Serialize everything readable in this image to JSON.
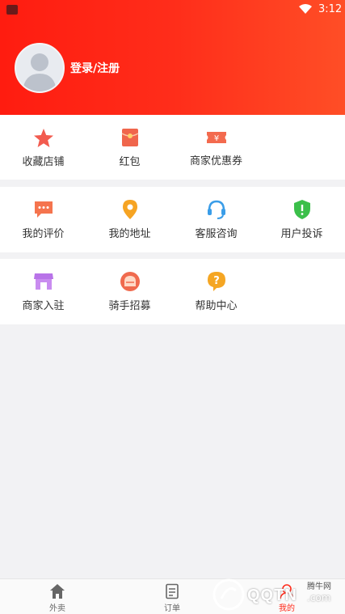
{
  "status_bar": {
    "time": "3:12",
    "wifi_icon": "wifi-icon",
    "app_icon": "notification-app-icon"
  },
  "header": {
    "login_label": "登录/注册",
    "avatar_icon": "default-avatar-icon",
    "gradient_colors": [
      "#ff1c10",
      "#ff4e26"
    ]
  },
  "sections": [
    {
      "items": [
        {
          "label": "收藏店铺",
          "icon": "star-icon",
          "color": "#f25b4f"
        },
        {
          "label": "红包",
          "icon": "red-envelope-icon",
          "color": "#f0664c"
        },
        {
          "label": "商家优惠券",
          "icon": "coupon-icon",
          "color": "#f36a4e"
        }
      ]
    },
    {
      "items": [
        {
          "label": "我的评价",
          "icon": "comment-icon",
          "color": "#f5744e"
        },
        {
          "label": "我的地址",
          "icon": "location-pin-icon",
          "color": "#f6a423"
        },
        {
          "label": "客服咨询",
          "icon": "headset-icon",
          "color": "#3a9de8"
        },
        {
          "label": "用户投诉",
          "icon": "shield-icon",
          "color": "#3bbf4a"
        }
      ]
    },
    {
      "items": [
        {
          "label": "商家入驻",
          "icon": "storefront-icon",
          "color": "#b873e8"
        },
        {
          "label": "骑手招募",
          "icon": "rider-icon",
          "color": "#f06a4e"
        },
        {
          "label": "帮助中心",
          "icon": "help-icon",
          "color": "#f5a623"
        }
      ]
    }
  ],
  "tabbar": {
    "tabs": [
      {
        "label": "外卖",
        "icon": "home-icon"
      },
      {
        "label": "订单",
        "icon": "order-list-icon"
      },
      {
        "label": "我的",
        "icon": "profile-icon"
      }
    ],
    "active_color": "#ff2a1a"
  },
  "watermark": {
    "text": "QQTN",
    "suffix": ".com",
    "cn": "腾牛网"
  }
}
